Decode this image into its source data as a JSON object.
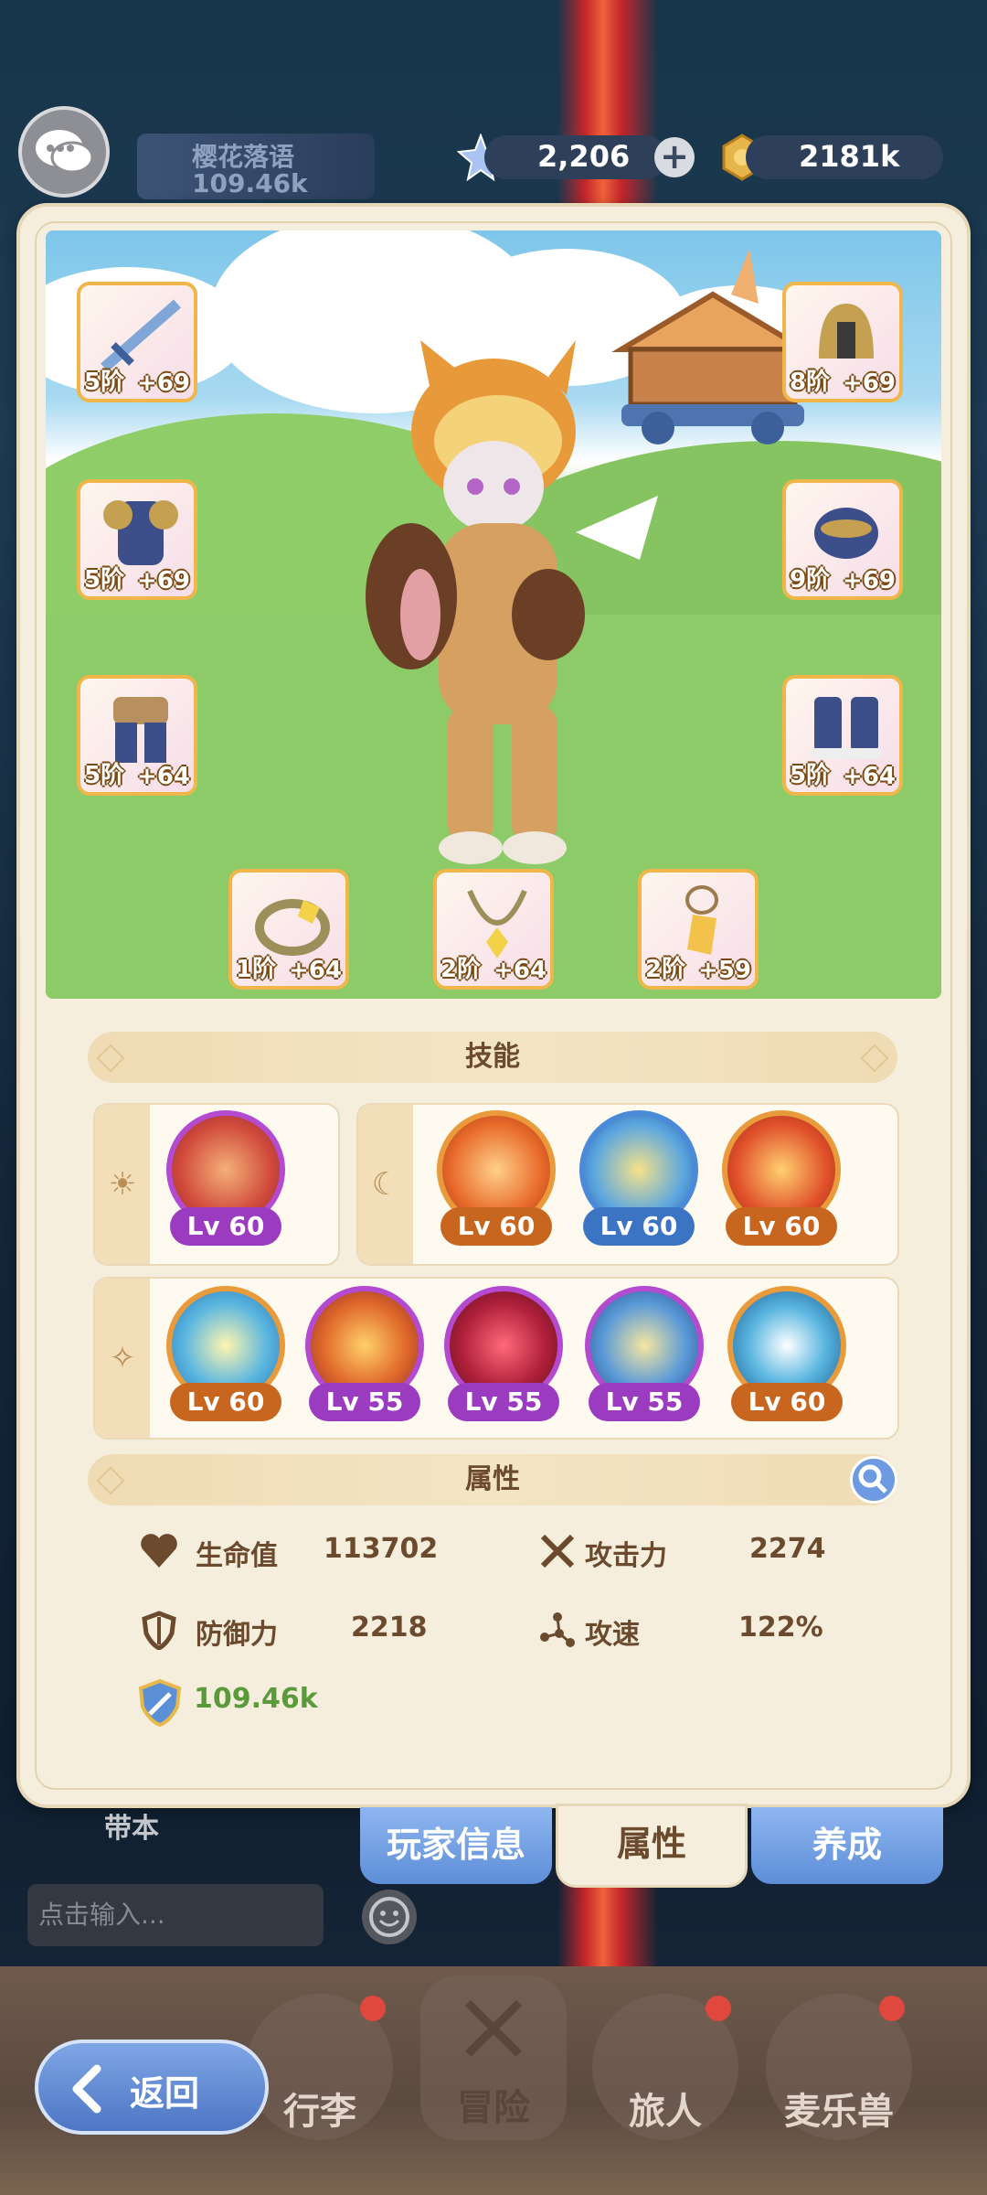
{
  "header": {
    "player_name": "樱花落语",
    "player_power": "109.46k",
    "currency_gem": "2,206",
    "currency_gold": "2181k"
  },
  "equipment": [
    {
      "slot": "weapon",
      "tier": "5阶",
      "plus": "+69"
    },
    {
      "slot": "armor",
      "tier": "5阶",
      "plus": "+69"
    },
    {
      "slot": "pants",
      "tier": "5阶",
      "plus": "+64"
    },
    {
      "slot": "helmet",
      "tier": "8阶",
      "plus": "+69"
    },
    {
      "slot": "gloves",
      "tier": "9阶",
      "plus": "+69"
    },
    {
      "slot": "boots",
      "tier": "5阶",
      "plus": "+64"
    },
    {
      "slot": "ring",
      "tier": "1阶",
      "plus": "+64"
    },
    {
      "slot": "necklace",
      "tier": "2阶",
      "plus": "+64"
    },
    {
      "slot": "charm",
      "tier": "2阶",
      "plus": "+59"
    }
  ],
  "skills": {
    "title": "技能",
    "row1_left": [
      {
        "lv": "Lv 60",
        "style": "purple"
      }
    ],
    "row1_right": [
      {
        "lv": "Lv 60",
        "style": "orange"
      },
      {
        "lv": "Lv 60",
        "style": "blue"
      },
      {
        "lv": "Lv 60",
        "style": "orange"
      }
    ],
    "row2": [
      {
        "lv": "Lv 60",
        "style": "orange"
      },
      {
        "lv": "Lv 55",
        "style": "purple"
      },
      {
        "lv": "Lv 55",
        "style": "purple"
      },
      {
        "lv": "Lv 55",
        "style": "purple"
      },
      {
        "lv": "Lv 60",
        "style": "orange"
      }
    ]
  },
  "attributes": {
    "title": "属性",
    "hp_label": "生命值",
    "hp_value": "113702",
    "atk_label": "攻击力",
    "atk_value": "2274",
    "def_label": "防御力",
    "def_value": "2218",
    "spd_label": "攻速",
    "spd_value": "122%",
    "power_value": "109.46k"
  },
  "tabs": {
    "player_info": "玩家信息",
    "attributes": "属性",
    "training": "养成"
  },
  "chat": {
    "side_label": "带本",
    "input_placeholder": "点击输入..."
  },
  "bottom_nav": {
    "back": "返回",
    "luggage": "行李",
    "adventure": "冒险",
    "traveler": "旅人",
    "pet": "麦乐兽"
  },
  "colors": {
    "panel": "#f6eedd",
    "accent_orange": "#c8651e",
    "accent_blue": "#3c74c4",
    "accent_purple": "#9a3bc0",
    "power_green": "#5a9a3a"
  }
}
